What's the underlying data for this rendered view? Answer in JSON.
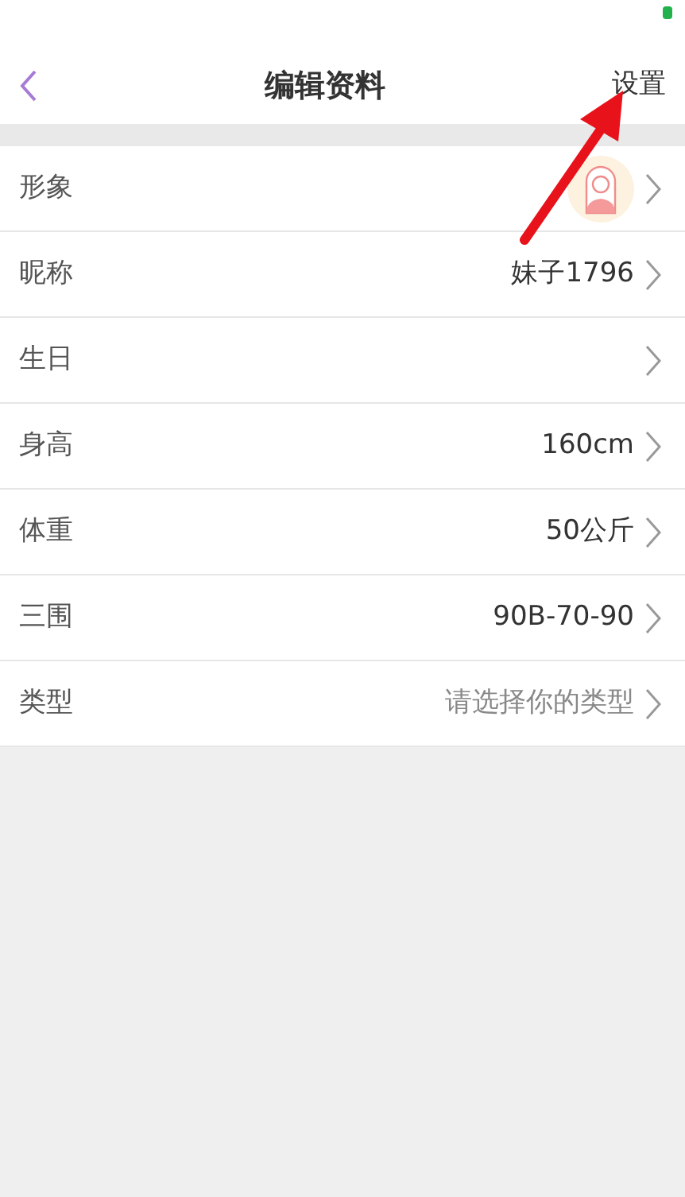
{
  "header": {
    "title": "编辑资料",
    "action": "设置"
  },
  "rows": [
    {
      "kind": "avatar",
      "label": "形象"
    },
    {
      "kind": "value",
      "label": "昵称",
      "value": "妹子1796"
    },
    {
      "kind": "empty",
      "label": "生日"
    },
    {
      "kind": "value",
      "label": "身高",
      "value": "160cm"
    },
    {
      "kind": "value",
      "label": "体重",
      "value": "50公斤"
    },
    {
      "kind": "value",
      "label": "三围",
      "value": "90B-70-90"
    },
    {
      "kind": "hint",
      "label": "类型",
      "value": "请选择你的类型"
    }
  ]
}
